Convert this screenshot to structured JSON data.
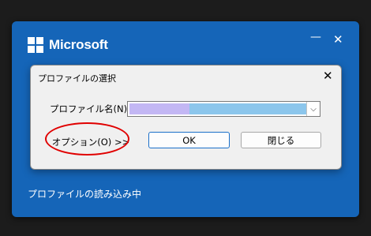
{
  "splash": {
    "brand": "Microsoft",
    "minimize_glyph": "—",
    "close_glyph": "✕",
    "loading_text": "プロファイルの読み込み中",
    "background_color": "#1565b8"
  },
  "dialog": {
    "title": "プロファイルの選択",
    "close_glyph": "✕",
    "profile_label": "プロファイル名(N):",
    "profile_value": "",
    "dropdown_glyph": "⌵",
    "options_button": "オプション(O) >>",
    "ok_button": "OK",
    "close_button": "閉じる"
  },
  "colors": {
    "annotation": "#e00000",
    "ok_border": "#1a6fc8"
  }
}
